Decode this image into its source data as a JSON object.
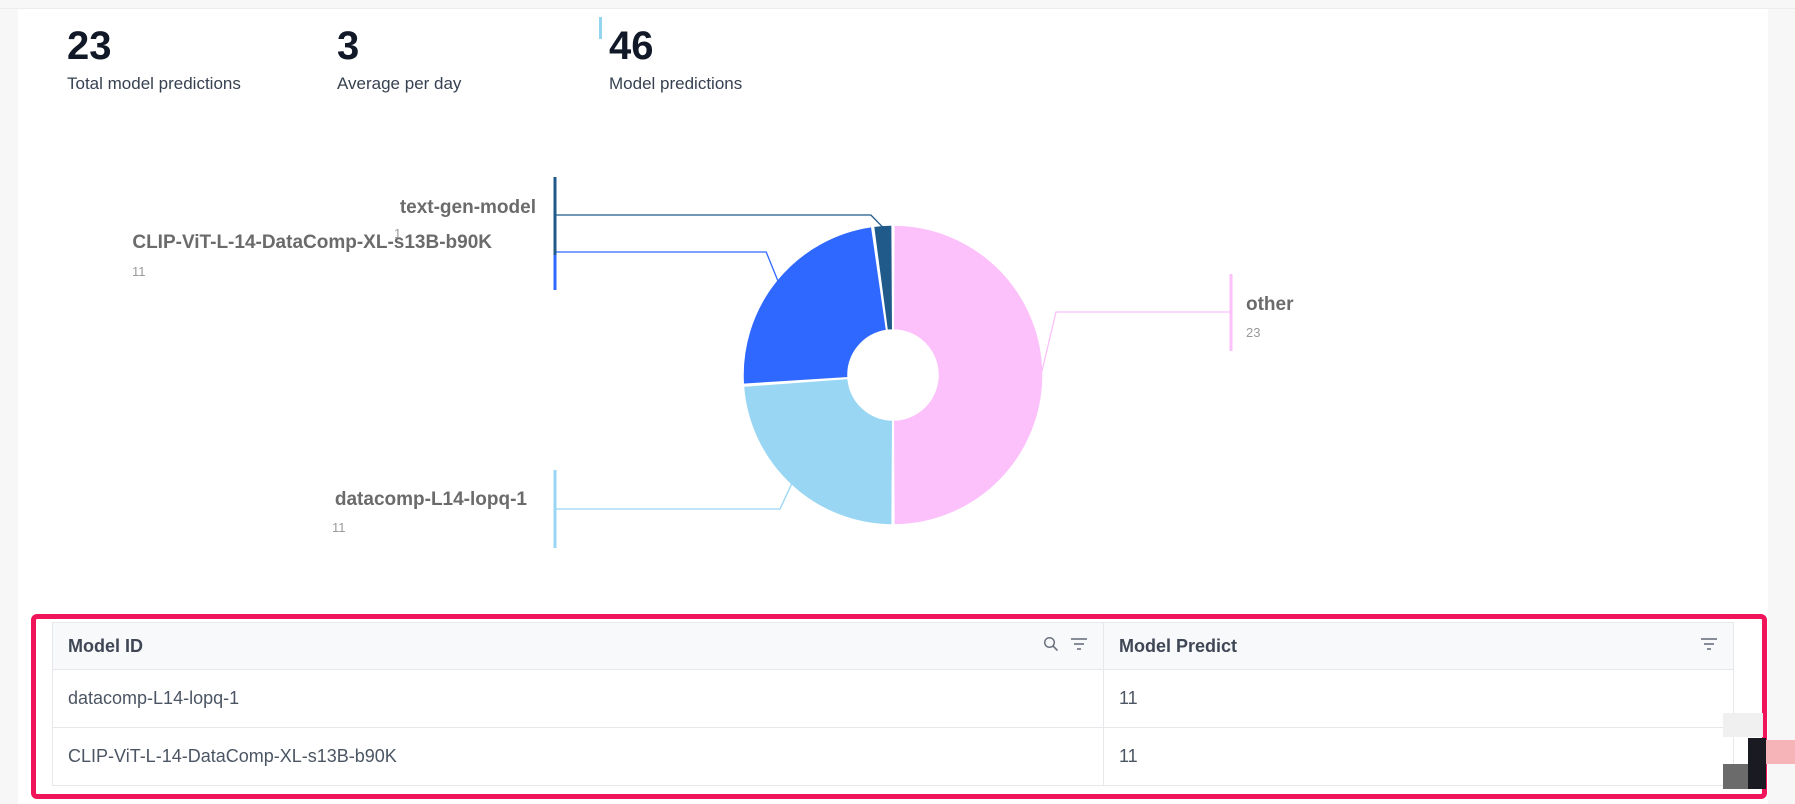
{
  "stats": [
    {
      "value": "23",
      "label": "Total model predictions"
    },
    {
      "value": "3",
      "label": "Average per day"
    },
    {
      "value": "46",
      "label": "Model predictions"
    }
  ],
  "chart_data": {
    "type": "pie",
    "categories": [
      "other",
      "datacomp-L14-lopq-1",
      "CLIP-ViT-L-14-DataComp-XL-s13B-b90K",
      "text-gen-model"
    ],
    "values": [
      23,
      11,
      11,
      1
    ],
    "colors": [
      "#fcc0fb",
      "#98d6f3",
      "#2f68ff",
      "#1f5a8a"
    ],
    "labels": [
      {
        "name": "other",
        "value": "23"
      },
      {
        "name": "datacomp-L14-lopq-1",
        "value": "11"
      },
      {
        "name": "CLIP-ViT-L-14-DataComp-XL-s13B-b90K",
        "value": "11"
      },
      {
        "name": "text-gen-model",
        "value": "1"
      }
    ]
  },
  "table": {
    "headers": [
      "Model ID",
      "Model Predict"
    ],
    "rows": [
      [
        "datacomp-L14-lopq-1",
        "11"
      ],
      [
        "CLIP-ViT-L-14-DataComp-XL-s13B-b90K",
        "11"
      ]
    ]
  },
  "icons": {
    "search": "search-icon",
    "filter": "filter-icon"
  },
  "accent": "#f0145a"
}
